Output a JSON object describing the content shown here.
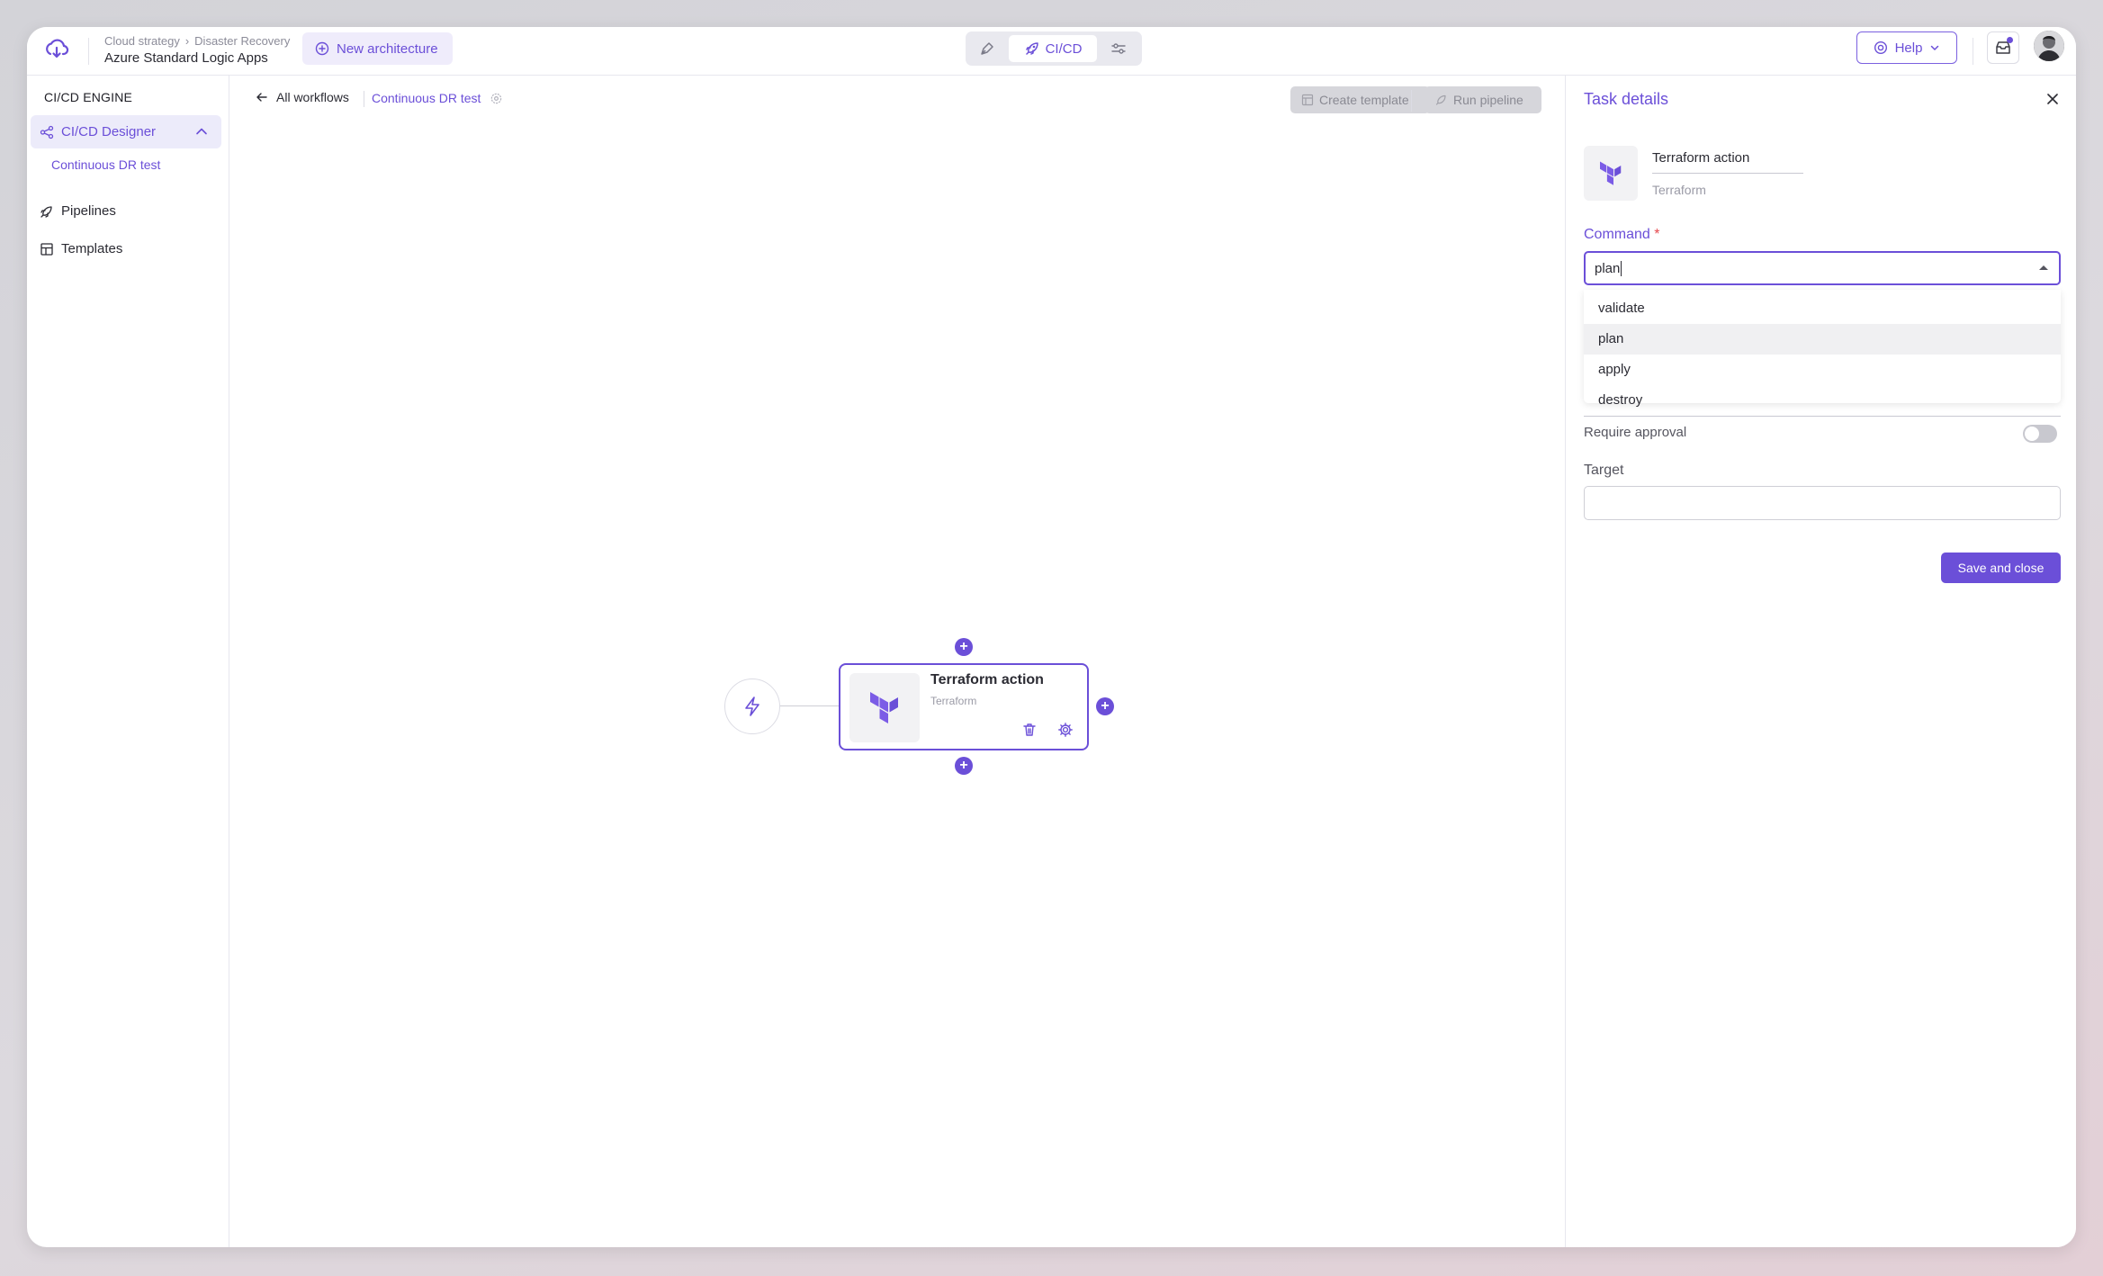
{
  "header": {
    "breadcrumb": [
      "Cloud strategy",
      "Disaster Recovery"
    ],
    "breadcrumb_separator": "›",
    "app_title": "Azure Standard Logic Apps",
    "new_architecture_label": "New architecture",
    "mode_active_label": "CI/CD",
    "help_label": "Help"
  },
  "sidebar": {
    "title": "CI/CD ENGINE",
    "designer_label": "CI/CD Designer",
    "designer_sub_item": "Continuous DR test",
    "items": [
      {
        "label": "Pipelines",
        "icon": "rocket-icon"
      },
      {
        "label": "Templates",
        "icon": "layout-icon"
      }
    ]
  },
  "canvas": {
    "back_label": "All workflows",
    "workflow_name": "Continuous DR test",
    "create_template_label": "Create template",
    "run_pipeline_label": "Run pipeline",
    "node": {
      "title": "Terraform action",
      "subtitle": "Terraform"
    }
  },
  "panel": {
    "title": "Task details",
    "task_name": "Terraform action",
    "task_type": "Terraform",
    "command_label": "Command",
    "command_required_mark": "*",
    "command_value": "plan",
    "command_options": [
      "validate",
      "plan",
      "apply",
      "destroy"
    ],
    "command_highlighted": "plan",
    "require_approval_label": "Require approval",
    "require_approval_on": false,
    "target_label": "Target",
    "target_value": "",
    "save_label": "Save and close"
  },
  "colors": {
    "accent": "#6b4fd8",
    "accent_soft": "#ecebfa",
    "disabled_bg": "#d6d6db",
    "required": "#e5484d"
  }
}
